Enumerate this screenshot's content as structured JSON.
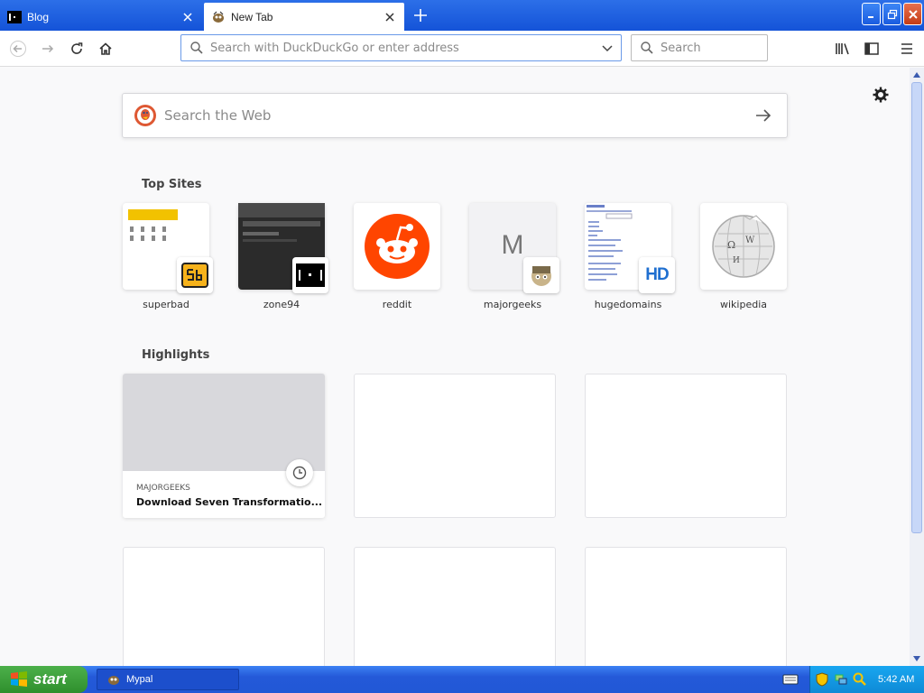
{
  "browser": {
    "tabs": [
      {
        "title": "Blog",
        "active": false,
        "icon": "blog-favicon"
      },
      {
        "title": "New Tab",
        "active": true,
        "icon": "mypal-favicon"
      }
    ],
    "urlbar": {
      "placeholder": "Search with DuckDuckGo or enter address",
      "value": ""
    },
    "searchbar": {
      "placeholder": "Search",
      "value": ""
    }
  },
  "newtab": {
    "web_search_placeholder": "Search the Web",
    "top_sites_title": "Top Sites",
    "top_sites": [
      {
        "label": "superbad"
      },
      {
        "label": "zone94"
      },
      {
        "label": "reddit"
      },
      {
        "label": "majorgeeks",
        "letter": "M"
      },
      {
        "label": "hugedomains",
        "badge_text": "HD"
      },
      {
        "label": "wikipedia"
      }
    ],
    "highlights_title": "Highlights",
    "highlights": [
      {
        "source": "MAJORGEEKS",
        "title": "Download Seven Transformatio..."
      }
    ]
  },
  "taskbar": {
    "start_label": "start",
    "tasks": [
      {
        "label": "Mypal"
      }
    ],
    "clock": "5:42 AM"
  },
  "colors": {
    "titlebar": "#1453d8",
    "accent_reddit": "#ff4500",
    "taskbar": "#2459d8",
    "start_green": "#3a9e38",
    "tray": "#0e8ad6"
  }
}
